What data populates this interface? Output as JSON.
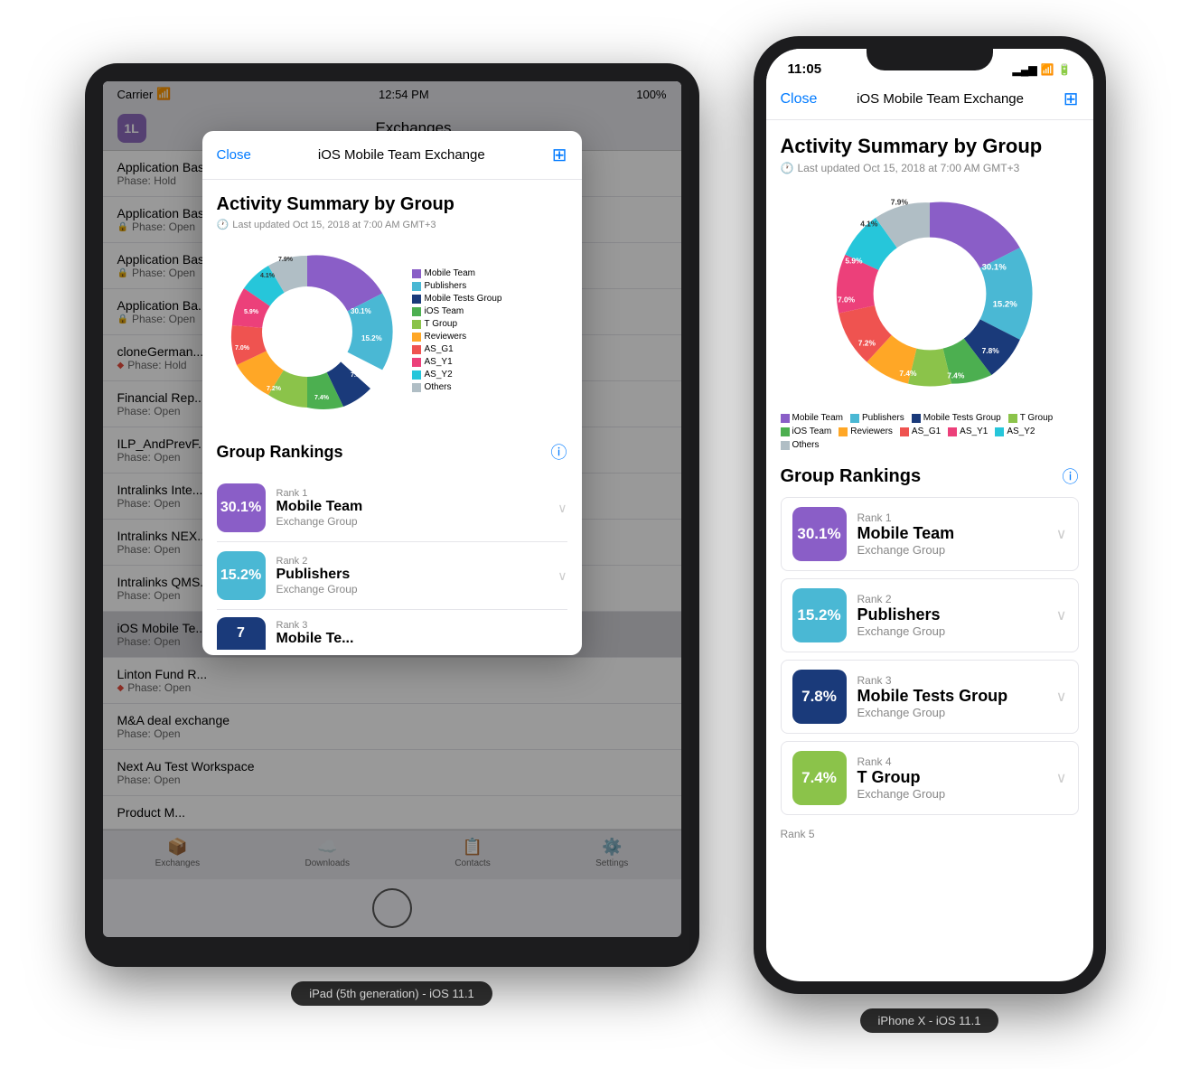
{
  "ipad": {
    "status": {
      "carrier": "Carrier",
      "wifi": "📶",
      "time": "12:54 PM",
      "battery": "100%"
    },
    "nav_title": "Exchanges",
    "list_items": [
      {
        "title": "Application Basics Training: Manager +",
        "subtitle": "Phase: Hold",
        "icon": ""
      },
      {
        "title": "Application Basics Training: Publisher",
        "subtitle": "Phase: Open",
        "icon": "lock"
      },
      {
        "title": "Application Basics Training: Q&A",
        "subtitle": "Phase: Open",
        "icon": "lock"
      },
      {
        "title": "Application Ba...",
        "subtitle": "Phase: Open",
        "icon": "lock"
      },
      {
        "title": "cloneGerman...",
        "subtitle": "Phase: Hold",
        "icon": "diamond"
      },
      {
        "title": "Financial Rep...",
        "subtitle": "Phase: Open",
        "icon": ""
      },
      {
        "title": "ILP_AndPrevF...",
        "subtitle": "Phase: Open",
        "icon": ""
      },
      {
        "title": "Intralinks Inte...",
        "subtitle": "Phase: Open",
        "icon": ""
      },
      {
        "title": "Intralinks NEX...",
        "subtitle": "Phase: Open",
        "icon": ""
      },
      {
        "title": "Intralinks QMS...",
        "subtitle": "Phase: Open",
        "icon": ""
      },
      {
        "title": "iOS Mobile Te...",
        "subtitle": "Phase: Open",
        "icon": ""
      },
      {
        "title": "Linton Fund R...",
        "subtitle": "Phase: Open",
        "icon": "diamond"
      },
      {
        "title": "M&A deal exchange",
        "subtitle": "Phase: Open",
        "icon": ""
      },
      {
        "title": "Next Au Test Workspace",
        "subtitle": "Phase: Open",
        "icon": ""
      },
      {
        "title": "Product M...",
        "subtitle": "",
        "icon": ""
      }
    ],
    "tabs": [
      "Exchanges",
      "Downloads",
      "Contacts",
      "Settings"
    ],
    "modal": {
      "close_label": "Close",
      "title": "iOS Mobile Team Exchange",
      "section_title": "Activity Summary by Group",
      "last_updated": "Last updated Oct 15, 2018 at 7:00 AM GMT+3",
      "chart_segments": [
        {
          "label": "Mobile Team",
          "value": 30.1,
          "color": "#8a5ec7",
          "startAngle": 0,
          "endAngle": 108.36
        },
        {
          "label": "Publishers",
          "value": 15.2,
          "color": "#4ab8d4",
          "startAngle": 108.36,
          "endAngle": 163.08
        },
        {
          "label": "Mobile Tests Group",
          "value": 7.8,
          "color": "#1a3a7a",
          "startAngle": 163.08,
          "endAngle": 191.16
        },
        {
          "label": "iOS Team",
          "value": 7.4,
          "color": "#4caf50",
          "startAngle": 191.16,
          "endAngle": 217.8
        },
        {
          "label": "T Group",
          "value": 7.4,
          "color": "#8bc34a",
          "startAngle": 217.8,
          "endAngle": 244.44
        },
        {
          "label": "Reviewers",
          "value": 7.2,
          "color": "#ffa726",
          "startAngle": 244.44,
          "endAngle": 270.36
        },
        {
          "label": "AS_G1",
          "value": 7.0,
          "color": "#ef5350",
          "startAngle": 270.36,
          "endAngle": 295.56
        },
        {
          "label": "AS_Y1",
          "value": 5.9,
          "color": "#ec407a",
          "startAngle": 295.56,
          "endAngle": 316.8
        },
        {
          "label": "AS_Y2",
          "value": 4.1,
          "color": "#26c6da",
          "startAngle": 316.8,
          "endAngle": 331.56
        },
        {
          "label": "Others",
          "value": 7.9,
          "color": "#b0bec5",
          "startAngle": 331.56,
          "endAngle": 360
        }
      ],
      "rankings_title": "Group Rankings",
      "rankings": [
        {
          "pct": "30.1%",
          "rank": "Rank 1",
          "name": "Mobile Team",
          "type": "Exchange Group",
          "color": "#8a5ec7"
        },
        {
          "pct": "15.2%",
          "rank": "Rank 2",
          "name": "Publishers",
          "type": "Exchange Group",
          "color": "#4ab8d4"
        },
        {
          "pct": "7",
          "rank": "Rank 3",
          "name": "Mobile Te...",
          "type": "",
          "color": "#1a3a7a"
        }
      ]
    }
  },
  "iphone": {
    "status": {
      "time": "11:05",
      "signal": "▂▄▆",
      "wifi": "wifi",
      "battery": "battery"
    },
    "nav": {
      "close_label": "Close",
      "title": "iOS Mobile Team Exchange",
      "grid_icon": "⊞"
    },
    "content": {
      "section_title": "Activity Summary by Group",
      "last_updated": "Last updated Oct 15, 2018 at 7:00 AM GMT+3",
      "chart_segments": [
        {
          "label": "Mobile Team",
          "value": 30.1,
          "color": "#8a5ec7"
        },
        {
          "label": "Publishers",
          "value": 15.2,
          "color": "#4ab8d4"
        },
        {
          "label": "Mobile Tests Group",
          "value": 7.8,
          "color": "#1a3a7a"
        },
        {
          "label": "T Group",
          "value": 7.4,
          "color": "#8bc34a"
        },
        {
          "label": "iOS Team",
          "value": 7.4,
          "color": "#4caf50"
        },
        {
          "label": "Reviewers",
          "value": 7.2,
          "color": "#ffa726"
        },
        {
          "label": "AS_G1",
          "value": 7.0,
          "color": "#ef5350"
        },
        {
          "label": "AS_Y1",
          "value": 5.9,
          "color": "#ec407a"
        },
        {
          "label": "AS_Y2",
          "value": 4.1,
          "color": "#26c6da"
        },
        {
          "label": "Others",
          "value": 7.9,
          "color": "#b0bec5"
        }
      ],
      "rankings_title": "Group Rankings",
      "rankings": [
        {
          "pct": "30.1%",
          "rank": "Rank 1",
          "name": "Mobile Team",
          "type": "Exchange Group",
          "color": "#8a5ec7"
        },
        {
          "pct": "15.2%",
          "rank": "Rank 2",
          "name": "Publishers",
          "type": "Exchange Group",
          "color": "#4ab8d4"
        },
        {
          "pct": "7.8%",
          "rank": "Rank 3",
          "name": "Mobile Tests Group",
          "type": "Exchange Group",
          "color": "#1a3a7a"
        },
        {
          "pct": "7.4%",
          "rank": "Rank 4",
          "name": "T Group",
          "type": "Exchange Group",
          "color": "#8bc34a"
        }
      ]
    }
  },
  "ipad_label": "iPad (5th generation) - iOS 11.1",
  "iphone_label": "iPhone X - iOS 11.1"
}
